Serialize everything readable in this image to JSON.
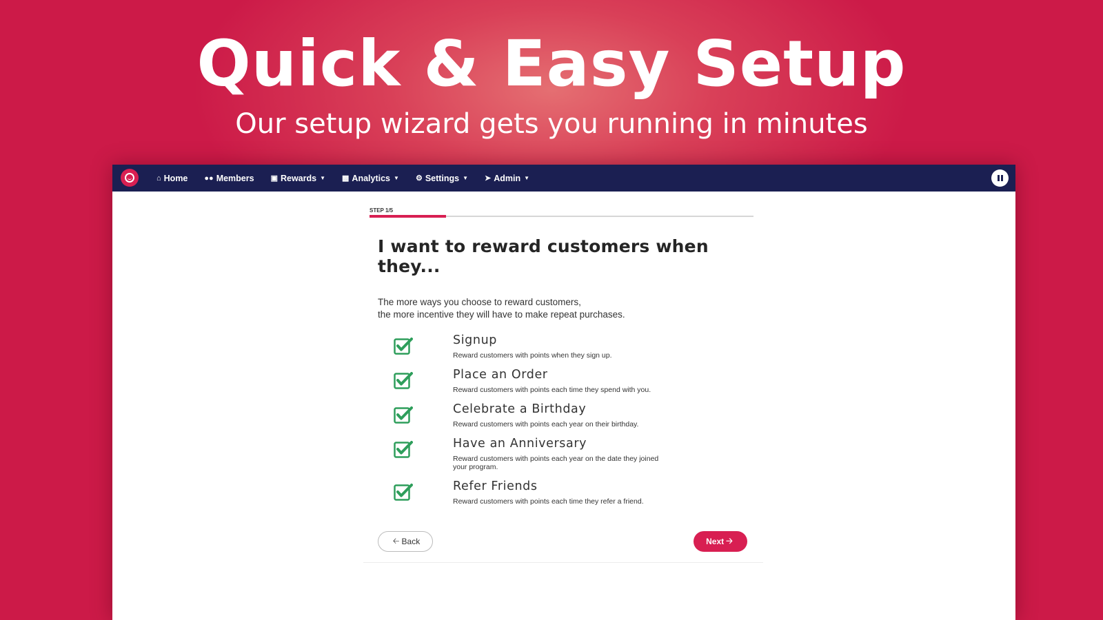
{
  "hero": {
    "title": "Quick & Easy Setup",
    "subtitle": "Our setup wizard gets you running in minutes"
  },
  "navbar": {
    "items": [
      {
        "label": "Home",
        "icon": "home-icon",
        "has_caret": false
      },
      {
        "label": "Members",
        "icon": "users-icon",
        "has_caret": false
      },
      {
        "label": "Rewards",
        "icon": "gift-icon",
        "has_caret": true
      },
      {
        "label": "Analytics",
        "icon": "bar-chart-icon",
        "has_caret": true
      },
      {
        "label": "Settings",
        "icon": "cogs-icon",
        "has_caret": true
      },
      {
        "label": "Admin",
        "icon": "rocket-icon",
        "has_caret": true
      }
    ],
    "right_icon": "pause-icon"
  },
  "wizard": {
    "step_label": "STEP 1/5",
    "progress": 0.2,
    "title": "I want to reward customers when they...",
    "description_line1": "The more ways you choose to reward customers,",
    "description_line2": "the more incentive they will have to make repeat purchases.",
    "options": [
      {
        "title": "Signup",
        "description": "Reward customers with points when they sign up.",
        "checked": true
      },
      {
        "title": "Place an Order",
        "description": "Reward customers with points each time they spend with you.",
        "checked": true
      },
      {
        "title": "Celebrate a Birthday",
        "description": "Reward customers with points each year on their birthday.",
        "checked": true
      },
      {
        "title": "Have an Anniversary",
        "description": "Reward customers with points each year on the date they joined your program.",
        "checked": true
      },
      {
        "title": "Refer Friends",
        "description": "Reward customers with points each time they refer a friend.",
        "checked": true
      }
    ],
    "back_label": "Back",
    "next_label": "Next"
  },
  "colors": {
    "brand": "#d81f52",
    "navbar": "#1b1f52",
    "check": "#2e9e5b"
  }
}
